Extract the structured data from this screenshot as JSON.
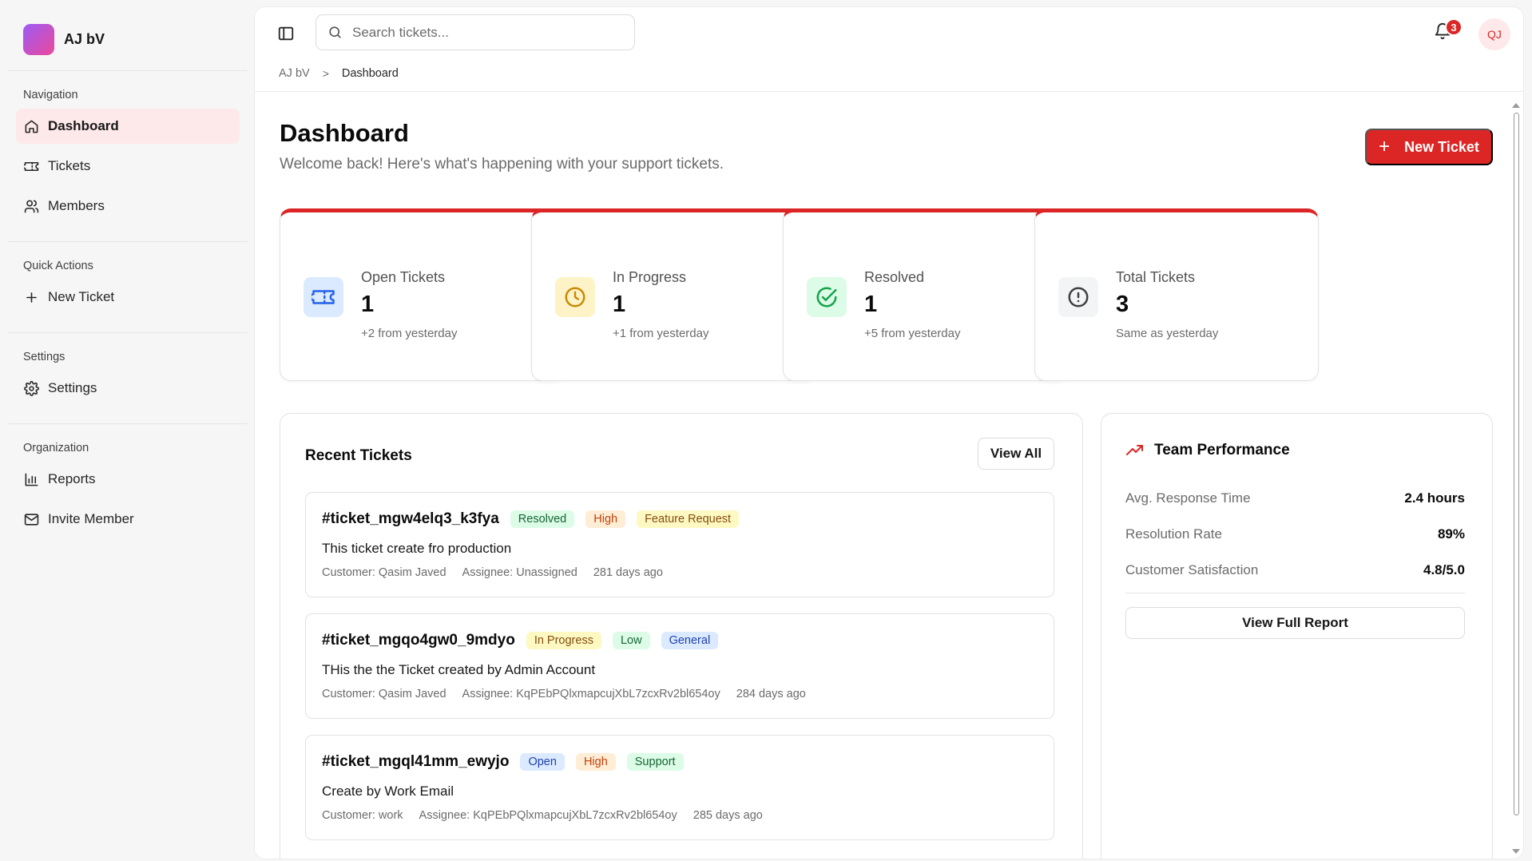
{
  "brand": {
    "name": "AJ bV",
    "gradient_from": "#9b5cf6",
    "gradient_to": "#ec4899"
  },
  "sidebar": {
    "groups": [
      {
        "label": "Navigation",
        "items": [
          {
            "label": "Dashboard",
            "icon": "home-icon",
            "active": true
          },
          {
            "label": "Tickets",
            "icon": "ticket-icon"
          },
          {
            "label": "Members",
            "icon": "users-icon"
          }
        ]
      },
      {
        "label": "Quick Actions",
        "items": [
          {
            "label": "New Ticket",
            "icon": "plus-icon"
          }
        ]
      },
      {
        "label": "Settings",
        "items": [
          {
            "label": "Settings",
            "icon": "gear-icon"
          }
        ]
      },
      {
        "label": "Organization",
        "items": [
          {
            "label": "Reports",
            "icon": "bar-chart-icon"
          },
          {
            "label": "Invite Member",
            "icon": "mail-icon"
          }
        ]
      }
    ]
  },
  "topbar": {
    "search_placeholder": "Search tickets...",
    "notification_count": "3",
    "avatar_initials": "QJ"
  },
  "breadcrumb": {
    "root": "AJ bV",
    "separator": ">",
    "current": "Dashboard"
  },
  "header": {
    "title": "Dashboard",
    "subtitle": "Welcome back! Here's what's happening with your support tickets.",
    "new_ticket_label": "New Ticket"
  },
  "stats": [
    {
      "label": "Open Tickets",
      "value": "1",
      "delta": "+2 from yesterday",
      "icon": "ticket-icon",
      "bg": "#dbeafe",
      "color": "#2563eb"
    },
    {
      "label": "In Progress",
      "value": "1",
      "delta": "+1 from yesterday",
      "icon": "clock-icon",
      "bg": "#fef3c7",
      "color": "#ca8a04"
    },
    {
      "label": "Resolved",
      "value": "1",
      "delta": "+5 from yesterday",
      "icon": "check-circle-icon",
      "bg": "#dcfce7",
      "color": "#16a34a"
    },
    {
      "label": "Total Tickets",
      "value": "3",
      "delta": "Same as yesterday",
      "icon": "alert-circle-icon",
      "bg": "#f3f4f6",
      "color": "#404040"
    }
  ],
  "recent": {
    "title": "Recent Tickets",
    "view_all_label": "View All",
    "tickets": [
      {
        "id": "#ticket_mgw4elq3_k3fya",
        "status": "Resolved",
        "priority": "High",
        "category": "Feature Request",
        "title": "This ticket create fro production",
        "customer": "Customer: Qasim Javed",
        "assignee": "Assignee: Unassigned",
        "age": "281 days ago"
      },
      {
        "id": "#ticket_mgqo4gw0_9mdyo",
        "status": "In Progress",
        "priority": "Low",
        "category": "General",
        "title": "THis the the Ticket created by Admin Account",
        "customer": "Customer: Qasim Javed",
        "assignee": "Assignee: KqPEbPQlxmapcujXbL7zcxRv2bl654oy",
        "age": "284 days ago"
      },
      {
        "id": "#ticket_mgql41mm_ewyjo",
        "status": "Open",
        "priority": "High",
        "category": "Support",
        "title": "Create by Work Email",
        "customer": "Customer: work",
        "assignee": "Assignee: KqPEbPQlxmapcujXbL7zcxRv2bl654oy",
        "age": "285 days ago"
      }
    ]
  },
  "team": {
    "title": "Team Performance",
    "metrics": [
      {
        "label": "Avg. Response Time",
        "value": "2.4 hours"
      },
      {
        "label": "Resolution Rate",
        "value": "89%"
      },
      {
        "label": "Customer Satisfaction",
        "value": "4.8/5.0"
      }
    ],
    "report_label": "View Full Report"
  },
  "colors": {
    "accent": "#dc2626",
    "tag_resolved_bg": "#dcfce7",
    "tag_resolved_fg": "#166534",
    "tag_high_bg": "#ffedd5",
    "tag_high_fg": "#c2410c",
    "tag_feature_bg": "#fef9c3",
    "tag_feature_fg": "#854d0e",
    "tag_progress_bg": "#fef9c3",
    "tag_progress_fg": "#854d0e",
    "tag_low_bg": "#dcfce7",
    "tag_low_fg": "#166534",
    "tag_general_bg": "#dbeafe",
    "tag_general_fg": "#1e40af",
    "tag_open_bg": "#dbeafe",
    "tag_open_fg": "#1e40af",
    "tag_support_bg": "#dcfce7",
    "tag_support_fg": "#166534"
  }
}
